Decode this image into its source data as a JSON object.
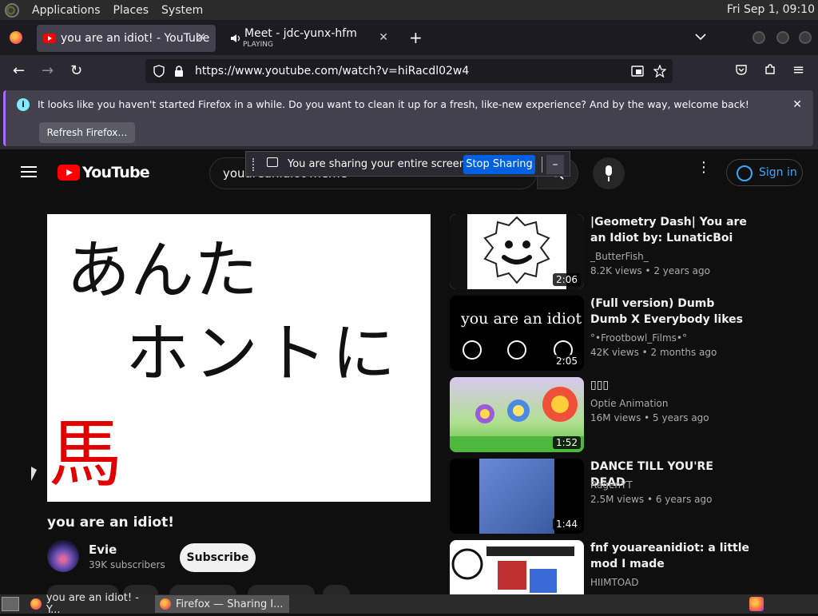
{
  "os": {
    "menu": [
      "Applications",
      "Places",
      "System"
    ],
    "clock": "Fri Sep  1, 09:10"
  },
  "tabs": [
    {
      "label": "you are an idiot! - YouTube",
      "close": "✕"
    },
    {
      "label": "Meet - jdc-yunx-hfm",
      "sub": "PLAYING",
      "close": "✕"
    }
  ],
  "toolbar": {
    "new_tab": "+",
    "tab_list": "⌄",
    "back": "←",
    "forward": "→",
    "reload": "↻",
    "menu": "≡",
    "url": "https://www.youtube.com/watch?v=hiRacdl02w4"
  },
  "notification": {
    "text": "It looks like you haven't started Firefox in a while. Do you want to clean it up for a fresh, like-new experience? And by the way, welcome back!",
    "button": "Refresh Firefox…",
    "close": "✕"
  },
  "sharing": {
    "text": "You are sharing your entire screen.",
    "stop": "Stop Sharing",
    "minimize": "–"
  },
  "youtube": {
    "logo": "YouTube",
    "search_value": "youareanidiot meme",
    "clear": "✕",
    "signin": "Sign in",
    "kebab": "⋮"
  },
  "video": {
    "line1": "あんた",
    "line2": "ホントに",
    "line3": "馬",
    "title": "you are an idiot!",
    "channel": "Evie",
    "subscribers": "39K subscribers",
    "subscribe": "Subscribe"
  },
  "recommendations": [
    {
      "title": "|Geometry Dash| You are an Idiot by: LunaticBoi (Unique…",
      "channel": "_ButterFish_",
      "meta": "8.2K views  •  2 years ago",
      "duration": "2:06"
    },
    {
      "title": "(Full version) Dumb Dumb X Everybody likes you X You are…",
      "channel": "°•Frootbowl_Films•°",
      "meta": "42K views  •  2 months ago",
      "duration": "2:05",
      "thumb_text": "you are an idiot"
    },
    {
      "title": "▯▯▯",
      "channel": "Optie Animation",
      "meta": "16M views  •  5 years ago",
      "duration": "1:52"
    },
    {
      "title": "DANCE TILL YOU'RE DEAD",
      "channel": "RagenYT",
      "meta": "2.5M views  •  6 years ago",
      "duration": "1:44"
    },
    {
      "title": "fnf youareanidiot: a little mod I made",
      "channel": "HIIMTOAD",
      "meta": "",
      "duration": ""
    }
  ],
  "taskbar": {
    "items": [
      "you are an idiot! - Y...",
      "Firefox — Sharing I..."
    ]
  },
  "colors": {
    "accent_blue": "#3ea6ff",
    "stop_sharing": "#0061e0",
    "youtube_red": "#ff0000",
    "background": "#0f0f0f"
  }
}
